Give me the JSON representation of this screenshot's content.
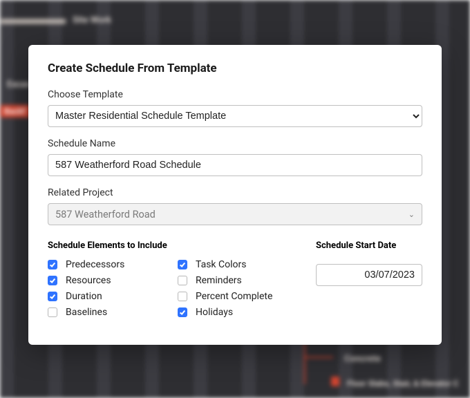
{
  "backdrop": {
    "sitework": "Site Work",
    "excav": "Excav",
    "backfill": "Backf",
    "concrete": "Concrete",
    "floor": "Floor Slabs, Stair, & Elevator C"
  },
  "modal": {
    "title": "Create Schedule From Template",
    "template": {
      "label": "Choose Template",
      "value": "Master Residential Schedule Template"
    },
    "name": {
      "label": "Schedule Name",
      "value": "587 Weatherford Road Schedule"
    },
    "project": {
      "label": "Related Project",
      "value": "587 Weatherford Road"
    },
    "elements": {
      "label": "Schedule Elements to Include",
      "col1": [
        {
          "label": "Predecessors",
          "checked": true
        },
        {
          "label": "Resources",
          "checked": true
        },
        {
          "label": "Duration",
          "checked": true
        },
        {
          "label": "Baselines",
          "checked": false
        }
      ],
      "col2": [
        {
          "label": "Task Colors",
          "checked": true
        },
        {
          "label": "Reminders",
          "checked": false
        },
        {
          "label": "Percent Complete",
          "checked": false
        },
        {
          "label": "Holidays",
          "checked": true
        }
      ]
    },
    "start": {
      "label": "Schedule Start Date",
      "value": "03/07/2023"
    }
  }
}
